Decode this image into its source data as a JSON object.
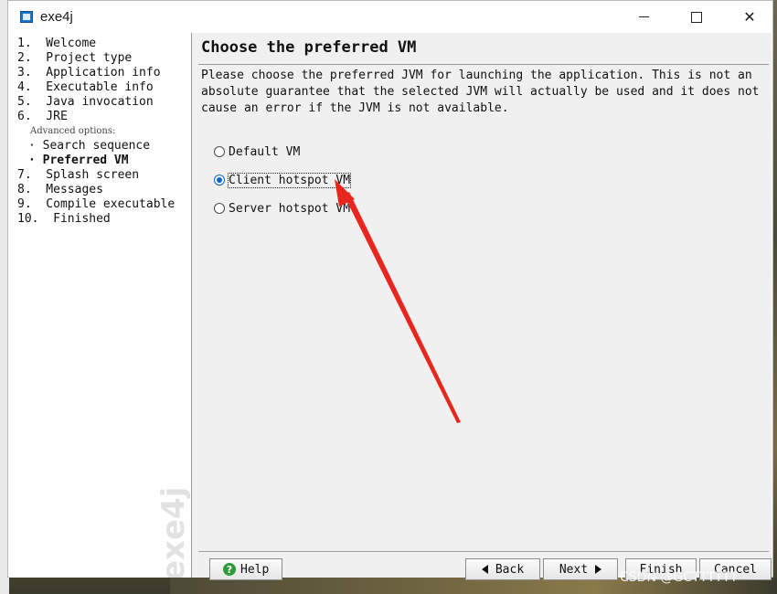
{
  "window": {
    "title": "exe4j",
    "icon": "exe4j-app-icon",
    "controls": [
      "minimize-icon",
      "maximize-icon",
      "close-icon"
    ]
  },
  "sidebar": {
    "steps": [
      {
        "label": "1.  Welcome"
      },
      {
        "label": "2.  Project type"
      },
      {
        "label": "3.  Application info"
      },
      {
        "label": "4.  Executable info"
      },
      {
        "label": "5.  Java invocation"
      },
      {
        "label": "6.  JRE"
      }
    ],
    "advanced_label": "Advanced options:",
    "advanced_items": [
      {
        "label": "Search sequence",
        "current": false
      },
      {
        "label": "Preferred VM",
        "current": true
      }
    ],
    "steps_after": [
      {
        "label": "7.  Splash screen"
      },
      {
        "label": "8.  Messages"
      },
      {
        "label": "9.  Compile executable"
      },
      {
        "label": "10.  Finished"
      }
    ],
    "watermark": "exe4j"
  },
  "main": {
    "title": "Choose the preferred VM",
    "description": "Please choose the preferred JVM for launching the application. This is not an absolute guarantee that the selected JVM will actually be used and it does not cause an error if the JVM is not available.",
    "options": [
      {
        "label": "Default VM",
        "selected": false
      },
      {
        "label": "Client hotspot VM",
        "selected": true
      },
      {
        "label": "Server hotspot VM",
        "selected": false
      }
    ]
  },
  "buttons": {
    "help": "Help",
    "back": "Back",
    "next": "Next",
    "finish": "Finish",
    "cancel": "Cancel"
  },
  "annotation": {
    "arrow_color": "#e8261d"
  },
  "watermark_text": "CSDN @GCTTTTTT"
}
